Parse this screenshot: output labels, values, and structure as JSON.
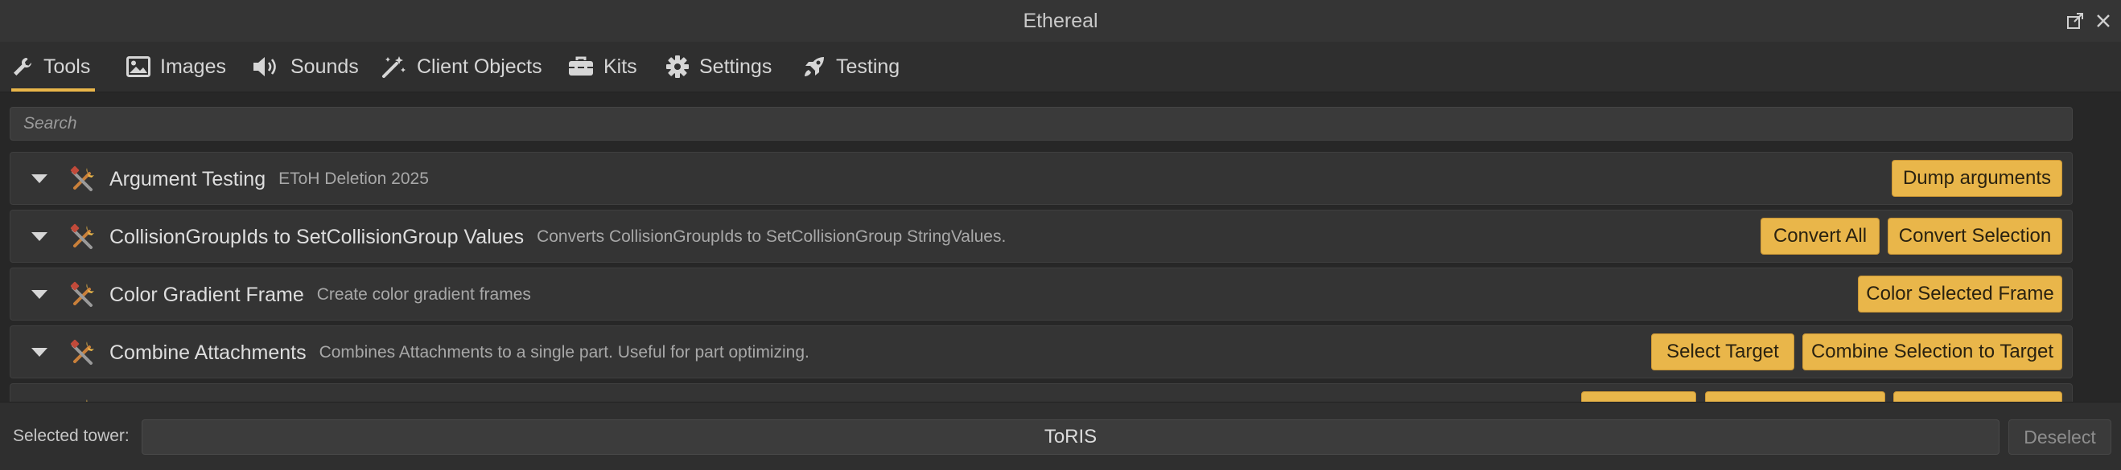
{
  "window": {
    "title": "Ethereal",
    "buttons": [
      "popout-icon",
      "close-icon"
    ]
  },
  "tabs": [
    {
      "label": "Tools",
      "icon": "wrench-icon",
      "active": true
    },
    {
      "label": "Images",
      "icon": "image-icon",
      "active": false
    },
    {
      "label": "Sounds",
      "icon": "speaker-icon",
      "active": false
    },
    {
      "label": "Client Objects",
      "icon": "magic-wand-icon",
      "active": false
    },
    {
      "label": "Kits",
      "icon": "toolbox-icon",
      "active": false
    },
    {
      "label": "Settings",
      "icon": "gear-icon",
      "active": false
    },
    {
      "label": "Testing",
      "icon": "rocket-icon",
      "active": false
    }
  ],
  "search": {
    "placeholder": "Search",
    "value": ""
  },
  "tools": [
    {
      "name": "Argument Testing",
      "description": "EToH Deletion 2025",
      "buttons": [
        "Dump arguments"
      ]
    },
    {
      "name": "CollisionGroupIds to SetCollisionGroup Values",
      "description": "Converts CollisionGroupIds to SetCollisionGroup StringValues.",
      "buttons": [
        "Convert All",
        "Convert Selection"
      ]
    },
    {
      "name": "Color Gradient Frame",
      "description": "Create color gradient frames",
      "buttons": [
        "Color Selected Frame"
      ]
    },
    {
      "name": "Combine Attachments",
      "description": "Combines Attachments to a single part. Useful for part optimizing.",
      "buttons": [
        "Select Target",
        "Combine Selection to Target"
      ]
    }
  ],
  "footer": {
    "selected_label": "Selected tower:",
    "selected_value": "ToRIS",
    "deselect_label": "Deselect"
  },
  "colors": {
    "accent": "#e9b64a",
    "background": "#272727",
    "panel": "#343434",
    "text": "#d8d8d8"
  }
}
